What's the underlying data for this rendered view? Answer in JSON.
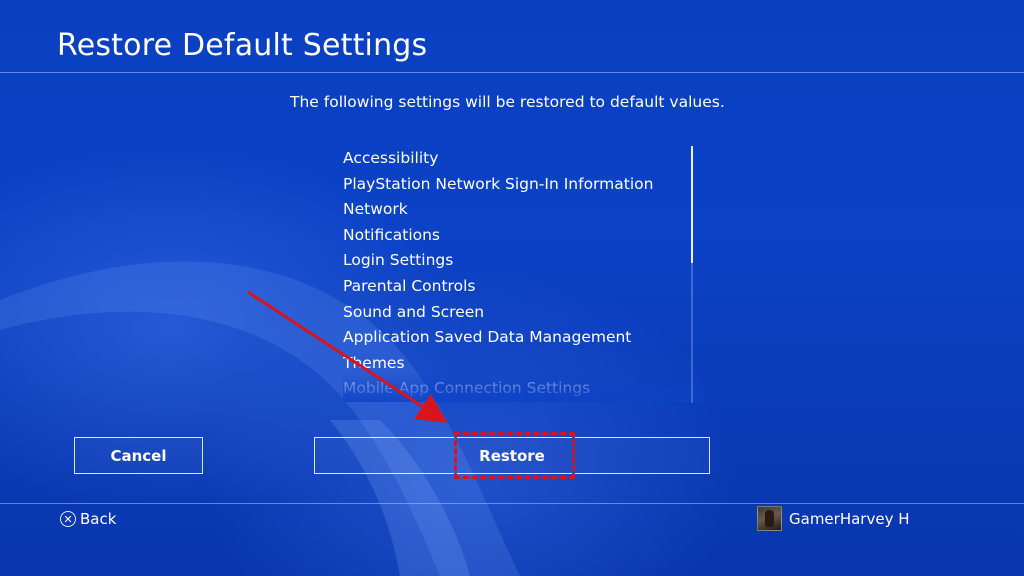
{
  "header": {
    "title": "Restore Default Settings"
  },
  "main": {
    "subtitle": "The following settings will be restored to default values.",
    "items": [
      "Accessibility",
      "PlayStation Network Sign-In Information",
      "Network",
      "Notifications",
      "Login Settings",
      "Parental Controls",
      "Sound and Screen",
      "Application Saved Data Management",
      "Themes",
      "Mobile App Connection Settings"
    ]
  },
  "buttons": {
    "cancel_label": "Cancel",
    "restore_label": "Restore"
  },
  "footer": {
    "back_icon": "cross-button-icon",
    "back_label": "Back",
    "user_name": "GamerHarvey H"
  },
  "annotation": {
    "color": "#d8141c"
  }
}
